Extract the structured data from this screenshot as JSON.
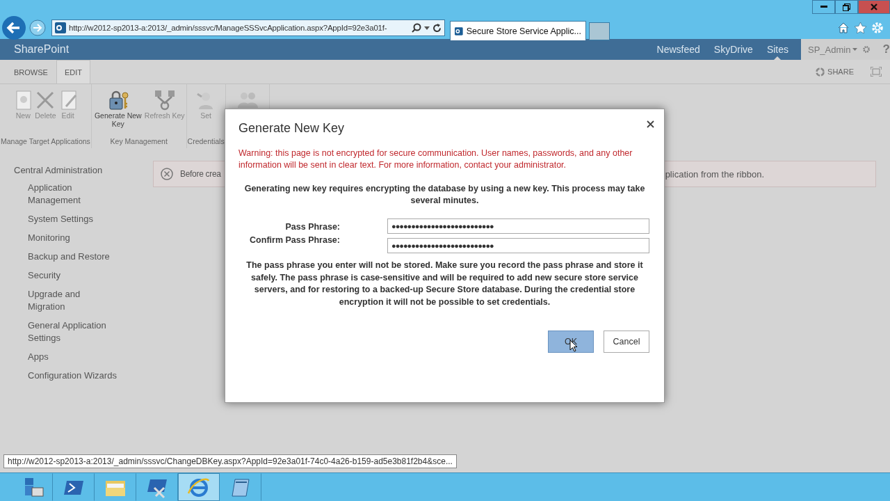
{
  "browser": {
    "address": "http://w2012-sp2013-a:2013/_admin/sssvc/ManageSSSvcApplication.aspx?AppId=92e3a01f-",
    "tabs": [
      {
        "title": "Secure Store Service Applic...",
        "selected": true
      }
    ]
  },
  "suite": {
    "brand": "SharePoint",
    "user": "SP_Admin",
    "help": "?",
    "links": [
      {
        "label": "Newsfeed",
        "selected": false
      },
      {
        "label": "SkyDrive",
        "selected": false
      },
      {
        "label": "Sites",
        "selected": true
      }
    ]
  },
  "ribbon": {
    "share": "SHARE",
    "tabs": [
      {
        "label": "BROWSE",
        "selected": false
      },
      {
        "label": "EDIT",
        "selected": true
      }
    ],
    "groups": [
      {
        "label": "Manage Target Applications",
        "buttons": [
          {
            "label": "New",
            "kind": "new",
            "disabled": true
          },
          {
            "label": "Delete",
            "kind": "delete",
            "disabled": true
          },
          {
            "label": "Edit",
            "kind": "edit",
            "disabled": true
          }
        ]
      },
      {
        "label": "Key Management",
        "buttons": [
          {
            "label": "Generate New Key",
            "kind": "key",
            "disabled": false
          },
          {
            "label": "Refresh Key",
            "kind": "refresh",
            "disabled": true
          }
        ]
      },
      {
        "label": "Credentials",
        "buttons": [
          {
            "label": "Set",
            "kind": "set",
            "disabled": true
          }
        ]
      }
    ]
  },
  "nav": {
    "heading": "Central Administration",
    "children": [
      {
        "label": "Application Management"
      },
      {
        "label": "System Settings"
      },
      {
        "label": "Monitoring"
      },
      {
        "label": "Backup and Restore"
      },
      {
        "label": "Security"
      },
      {
        "label": "Upgrade and Migration"
      },
      {
        "label": "General Application Settings"
      },
      {
        "label": "Apps"
      },
      {
        "label": "Configuration Wizards"
      }
    ]
  },
  "banner": {
    "message_start": "Before crea",
    "message_end": "plication from the ribbon."
  },
  "dialog": {
    "title": "Generate New Key",
    "warning": "Warning: this page is not encrypted for secure communication. User names, passwords, and any other information will be sent in clear text. For more information, contact your administrator.",
    "intro": "Generating new key requires encrypting the database by using a new key. This process may take several minutes.",
    "fields": [
      {
        "label": "Pass Phrase:",
        "value": "●●●●●●●●●●●●●●●●●●●●●●●●●●"
      },
      {
        "label": "Confirm Pass Phrase:",
        "value": "●●●●●●●●●●●●●●●●●●●●●●●●●●"
      }
    ],
    "note": "The pass phrase you enter will not be stored. Make sure you record the pass phrase and store it safely. The pass phrase is case-sensitive and will be required to add new secure store service servers, and for restoring to a backed-up Secure Store database. During the credential store encryption it will not be possible to set credentials.",
    "buttons": [
      {
        "label": "OK",
        "focused": true
      },
      {
        "label": "Cancel",
        "focused": false
      }
    ]
  },
  "status_url": "http://w2012-sp2013-a:2013/_admin/sssvc/ChangeDBKey.aspx?AppId=92e3a01f-74c0-4a26-b159-ad5e3b81f2b4&sce...",
  "taskbar": [
    {
      "kind": "server",
      "selected": false
    },
    {
      "kind": "shell",
      "selected": false
    },
    {
      "kind": "folder",
      "selected": false
    },
    {
      "kind": "tools",
      "selected": false
    },
    {
      "kind": "browser",
      "selected": true
    },
    {
      "kind": "notepad",
      "selected": false
    }
  ]
}
